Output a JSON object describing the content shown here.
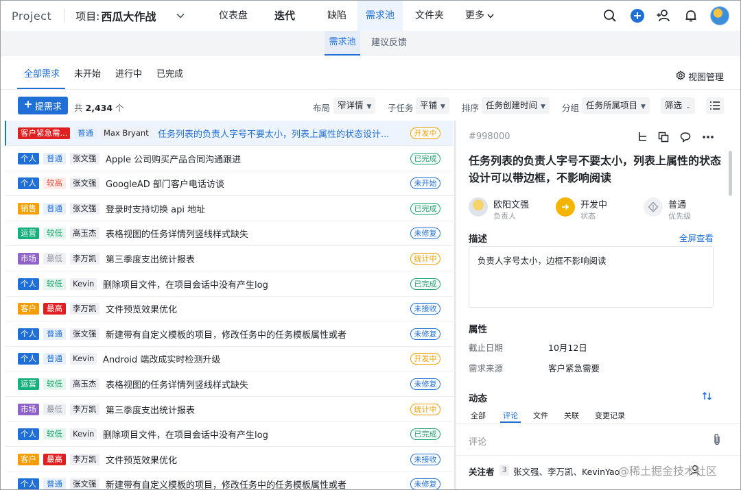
{
  "app": {
    "brand": "Project",
    "project_label": "项目:",
    "project_name": "西瓜大作战"
  },
  "nav": {
    "tabs": [
      "仪表盘",
      "迭代",
      "缺陷",
      "需求池",
      "文件夹"
    ],
    "more": "更多",
    "active": "需求池"
  },
  "subnav": {
    "tabs": [
      "需求池",
      "建议反馈"
    ],
    "active": "需求池"
  },
  "filters": {
    "tabs": [
      "全部需求",
      "未开始",
      "进行中",
      "已完成"
    ],
    "active": "全部需求",
    "view_manage": "视图管理"
  },
  "toolbar": {
    "add_label": "提需求",
    "total_prefix": "共",
    "total_count": "2,434",
    "total_suffix": "个",
    "layout_label": "布局",
    "layout_value": "窄详情",
    "subtask_label": "子任务",
    "subtask_value": "平铺",
    "sort_label": "排序",
    "sort_value": "任务创建时间",
    "group_label": "分组",
    "group_value": "任务所属项目",
    "filter_value": "筛选"
  },
  "colors": {
    "accent": "#1f6fd6",
    "categories": {
      "客户紧急需...": "#e02020",
      "个人": "#1f6fd6",
      "销售": "#f5a000",
      "运营": "#16b07c",
      "市场": "#8e62c9",
      "客户": "#f59c00"
    },
    "priorities": {
      "普通": {
        "bg": "#e8f0fc",
        "fg": "#1f6fd6"
      },
      "较高": {
        "bg": "#fdecea",
        "fg": "#e55340"
      },
      "较低": {
        "bg": "#e4f6ee",
        "fg": "#1aa36a"
      },
      "最低": {
        "bg": "#eef0f3",
        "fg": "#8f959e"
      },
      "最高": {
        "bg": "#e02020",
        "fg": "#ffffff"
      }
    },
    "statuses": {
      "开发中": "#f0a000",
      "已完成": "#1aa36a",
      "未开始": "#1f6fd6",
      "未修复": "#1f6fd6",
      "统计中": "#f0a000",
      "未接收": "#1f6fd6"
    }
  },
  "tasks": [
    {
      "category": "客户紧急需...",
      "priority": "普通",
      "owner": "Max Bryant",
      "title": "任务列表的负责人字号不要太小，列表上属性的状态设计...",
      "status": "开发中",
      "selected": true
    },
    {
      "category": "个人",
      "priority": "普通",
      "owner": "张文强",
      "title": "Apple 公司购买产品合同沟通跟进",
      "status": "已完成"
    },
    {
      "category": "个人",
      "priority": "较高",
      "owner": "张文强",
      "title": "GoogleAD 部门客户电话访谈",
      "status": "未开始"
    },
    {
      "category": "销售",
      "priority": "普通",
      "owner": "张文强",
      "title": "登录时支持切换 api 地址",
      "status": "已完成"
    },
    {
      "category": "运营",
      "priority": "较低",
      "owner": "高玉杰",
      "title": "表格视图的任务详情列竖线样式缺失",
      "status": "未修复"
    },
    {
      "category": "市场",
      "priority": "最低",
      "owner": "李万凯",
      "title": "第三季度支出统计报表",
      "status": "统计中"
    },
    {
      "category": "个人",
      "priority": "较低",
      "owner": "Kevin",
      "title": "删除项目文件，在项目会话中没有产生log",
      "status": "已完成"
    },
    {
      "category": "客户",
      "priority": "最高",
      "owner": "李万凯",
      "title": "文件预览效果优化",
      "status": "未接收"
    },
    {
      "category": "个人",
      "priority": "普通",
      "owner": "张文强",
      "title": "新建带有自定义模板的项目，修改任务中的任务模板属性或者",
      "status": "未修复"
    },
    {
      "category": "个人",
      "priority": "普通",
      "owner": "Kevin",
      "title": "Android 端改成实时检测升级",
      "status": "开发中"
    },
    {
      "category": "运营",
      "priority": "较低",
      "owner": "高玉杰",
      "title": "表格视图的任务详情列竖线样式缺失",
      "status": "未修复"
    },
    {
      "category": "市场",
      "priority": "最低",
      "owner": "李万凯",
      "title": "第三季度支出统计报表",
      "status": "统计中"
    },
    {
      "category": "个人",
      "priority": "较低",
      "owner": "Kevin",
      "title": "删除项目文件，在项目会话中没有产生log",
      "status": "已完成"
    },
    {
      "category": "客户",
      "priority": "最高",
      "owner": "李万凯",
      "title": "文件预览效果优化",
      "status": "未接收"
    },
    {
      "category": "个人",
      "priority": "普通",
      "owner": "张文强",
      "title": "新建带有自定义模板的项目，修改任务中的任务模板属性或者",
      "status": "未修复"
    }
  ],
  "detail": {
    "id": "#998000",
    "title": "任务列表的负责人字号不要太小，列表上属性的状态设计可以带边框，不影响阅读",
    "assignee": {
      "name": "欧阳文强",
      "label": "负责人"
    },
    "status": {
      "value": "开发中",
      "label": "状态"
    },
    "priority": {
      "value": "普通",
      "label": "优先级"
    },
    "description_heading": "描述",
    "fullscreen_label": "全屏查看",
    "description": "负责人字号太小，边框不影响阅读",
    "attributes_heading": "属性",
    "attributes": [
      {
        "key": "截止日期",
        "value": "10月12日"
      },
      {
        "key": "需求来源",
        "value": "客户紧急需要"
      }
    ],
    "activity_heading": "动态",
    "activity_tabs": [
      "全部",
      "评论",
      "文件",
      "关联",
      "变更记录"
    ],
    "activity_active": "评论",
    "comment_placeholder": "评论",
    "followers_label": "关注者",
    "followers_count": "3",
    "followers": "张文强、李万凯、KevinYao"
  },
  "watermark": "@稀土掘金技术社区"
}
